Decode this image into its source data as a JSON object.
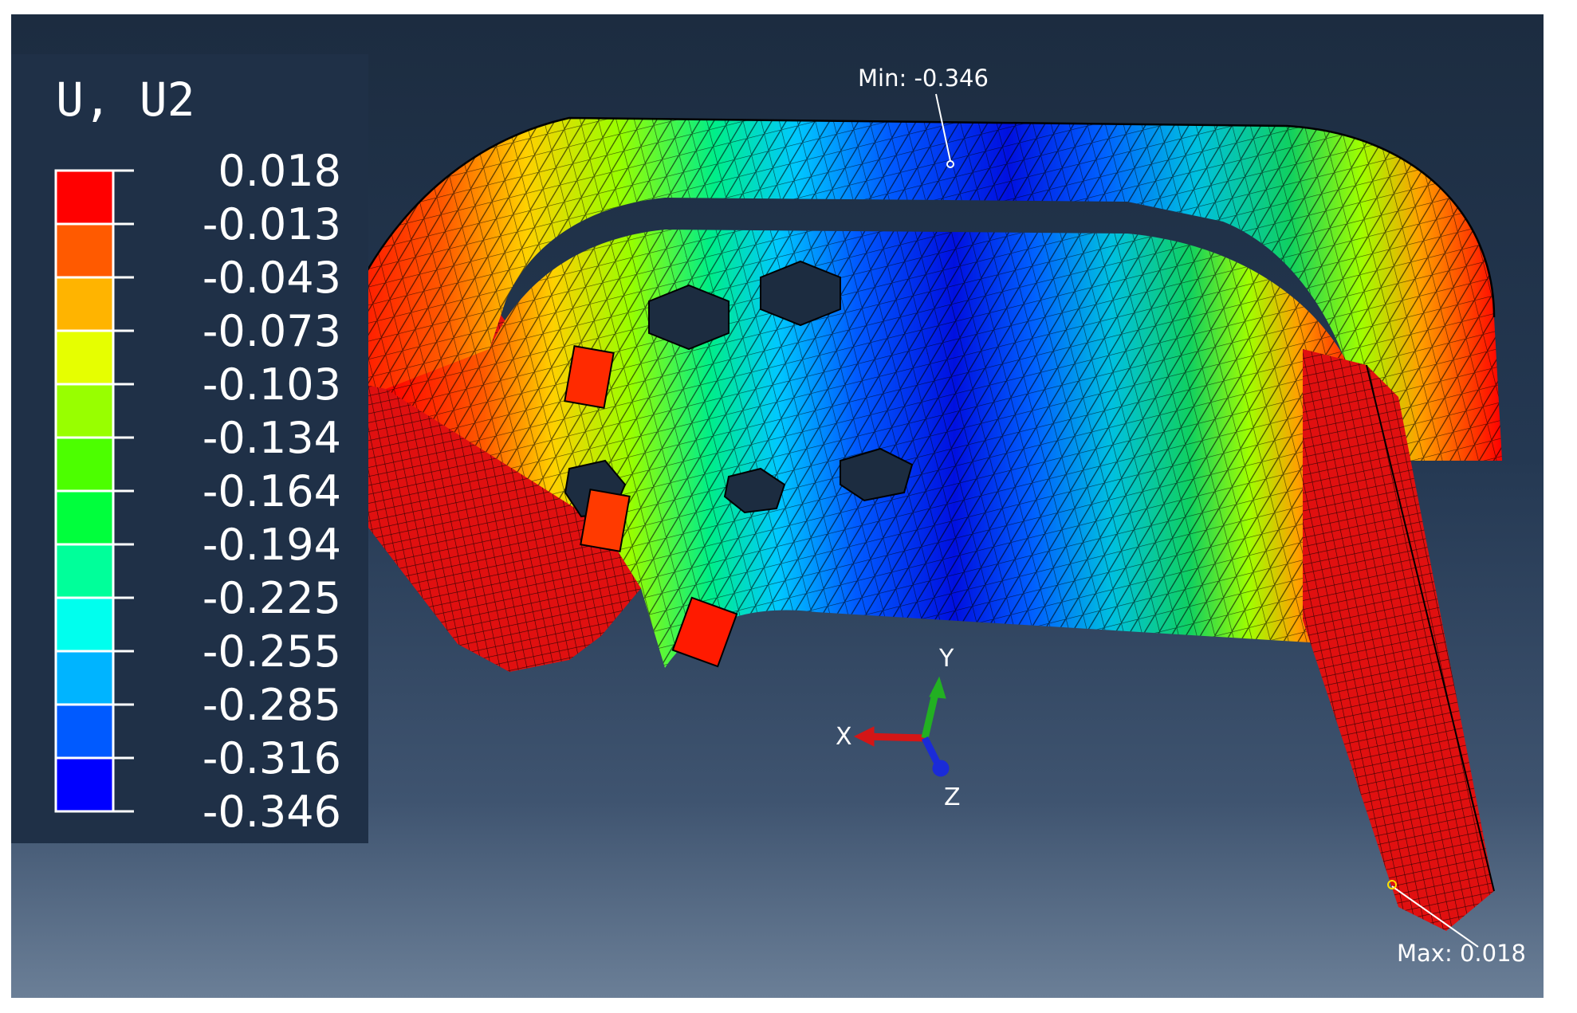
{
  "legend": {
    "title": "U, U2",
    "values": [
      "0.018",
      "-0.013",
      "-0.043",
      "-0.073",
      "-0.103",
      "-0.134",
      "-0.164",
      "-0.194",
      "-0.225",
      "-0.255",
      "-0.285",
      "-0.316",
      "-0.346"
    ],
    "band_colors": [
      "#ff0000",
      "#ff5a00",
      "#ffb400",
      "#e6ff00",
      "#98ff00",
      "#4cff00",
      "#00ff3c",
      "#00ff9a",
      "#00ffee",
      "#00b4ff",
      "#005aff",
      "#0000ff"
    ]
  },
  "probes": {
    "min_label": "Min: -0.346",
    "max_label": "Max: 0.018"
  },
  "triad": {
    "x_label": "X",
    "y_label": "Y",
    "z_label": "Z",
    "x_color": "#d41616",
    "y_color": "#22b022",
    "z_color": "#1a2bd8"
  }
}
